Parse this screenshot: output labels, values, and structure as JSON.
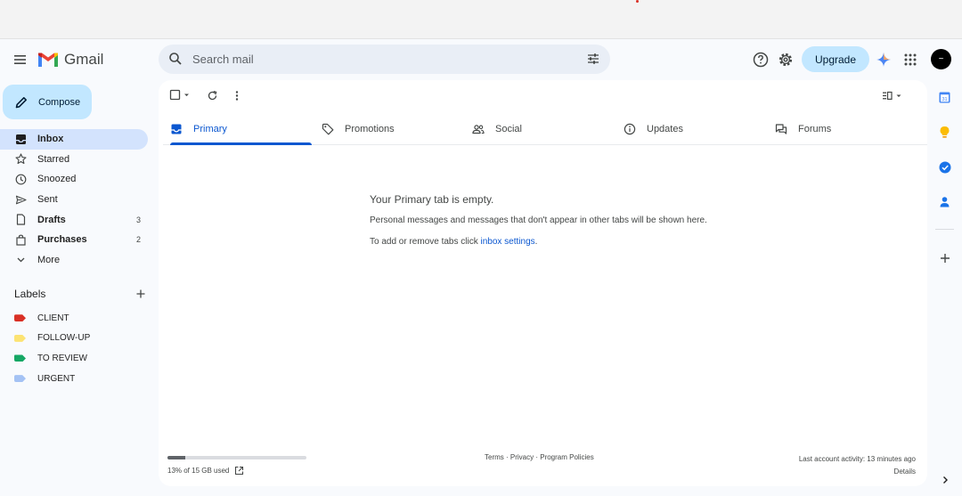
{
  "app": {
    "name": "Gmail"
  },
  "search": {
    "placeholder": "Search mail",
    "value": ""
  },
  "header": {
    "upgrade_label": "Upgrade",
    "avatar_initial": "~"
  },
  "compose_label": "Compose",
  "nav": [
    {
      "label": "Inbox",
      "count": "",
      "icon": "inbox-icon"
    },
    {
      "label": "Starred",
      "count": "",
      "icon": "star-icon"
    },
    {
      "label": "Snoozed",
      "count": "",
      "icon": "clock-icon"
    },
    {
      "label": "Sent",
      "count": "",
      "icon": "send-icon"
    },
    {
      "label": "Drafts",
      "count": "3",
      "icon": "draft-icon"
    },
    {
      "label": "Purchases",
      "count": "2",
      "icon": "shopping-bag-icon"
    },
    {
      "label": "More",
      "count": "",
      "icon": "chevron-down-icon"
    }
  ],
  "labels": {
    "title": "Labels",
    "items": [
      {
        "label": "CLIENT",
        "color": "#d93025"
      },
      {
        "label": "FOLLOW-UP",
        "color": "#fce373"
      },
      {
        "label": "TO REVIEW",
        "color": "#16a765"
      },
      {
        "label": "URGENT",
        "color": "#a4c2f4"
      }
    ]
  },
  "tabs": [
    {
      "label": "Primary",
      "icon": "inbox-icon"
    },
    {
      "label": "Promotions",
      "icon": "tag-icon"
    },
    {
      "label": "Social",
      "icon": "people-icon"
    },
    {
      "label": "Updates",
      "icon": "info-icon"
    },
    {
      "label": "Forums",
      "icon": "forum-icon"
    }
  ],
  "empty": {
    "title": "Your Primary tab is empty.",
    "desc": "Personal messages and messages that don't appear in other tabs will be shown here.",
    "hint_prefix": "To add or remove tabs click ",
    "hint_link": "inbox settings",
    "hint_suffix": "."
  },
  "footer": {
    "storage_text": "13% of 15 GB used",
    "storage_fraction": 0.13,
    "terms": "Terms",
    "privacy": "Privacy",
    "policies": "Program Policies",
    "separator": " · ",
    "activity": "Last account activity: 13 minutes ago",
    "details": "Details"
  },
  "colors": {
    "accent": "#0b57d0",
    "compose_bg": "#c2e7ff",
    "active_nav_bg": "#d3e3fd"
  }
}
